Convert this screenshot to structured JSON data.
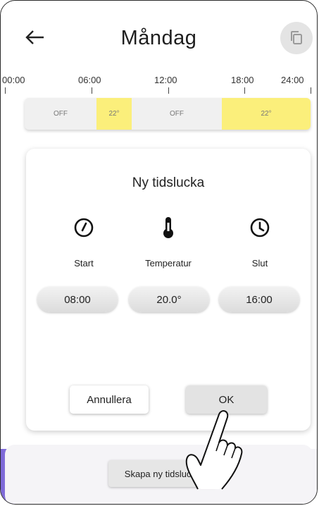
{
  "header": {
    "title": "Måndag",
    "back_icon": "arrow-left-icon",
    "copy_icon": "copy-icon"
  },
  "timeline": {
    "ticks": [
      "00:00",
      "06:00",
      "12:00",
      "18:00",
      "24:00"
    ],
    "segments": [
      {
        "label": "OFF",
        "state": "off"
      },
      {
        "label": "22°",
        "state": "on"
      },
      {
        "label": "OFF",
        "state": "off"
      },
      {
        "label": "22°",
        "state": "on"
      }
    ]
  },
  "dialog": {
    "title": "Ny tidslucka",
    "fields": [
      {
        "label": "Start",
        "value": "08:00",
        "icon": "clock-start-icon"
      },
      {
        "label": "Temperatur",
        "value": "20.0°",
        "icon": "thermometer-icon"
      },
      {
        "label": "Slut",
        "value": "16:00",
        "icon": "clock-end-icon"
      }
    ],
    "cancel_label": "Annullera",
    "ok_label": "OK"
  },
  "footer": {
    "create_label": "Skapa ny tidslucka"
  },
  "colors": {
    "on_segment": "#fbef7b",
    "off_segment": "#f0f0f0",
    "accent_gradient": "#7a64d6"
  }
}
